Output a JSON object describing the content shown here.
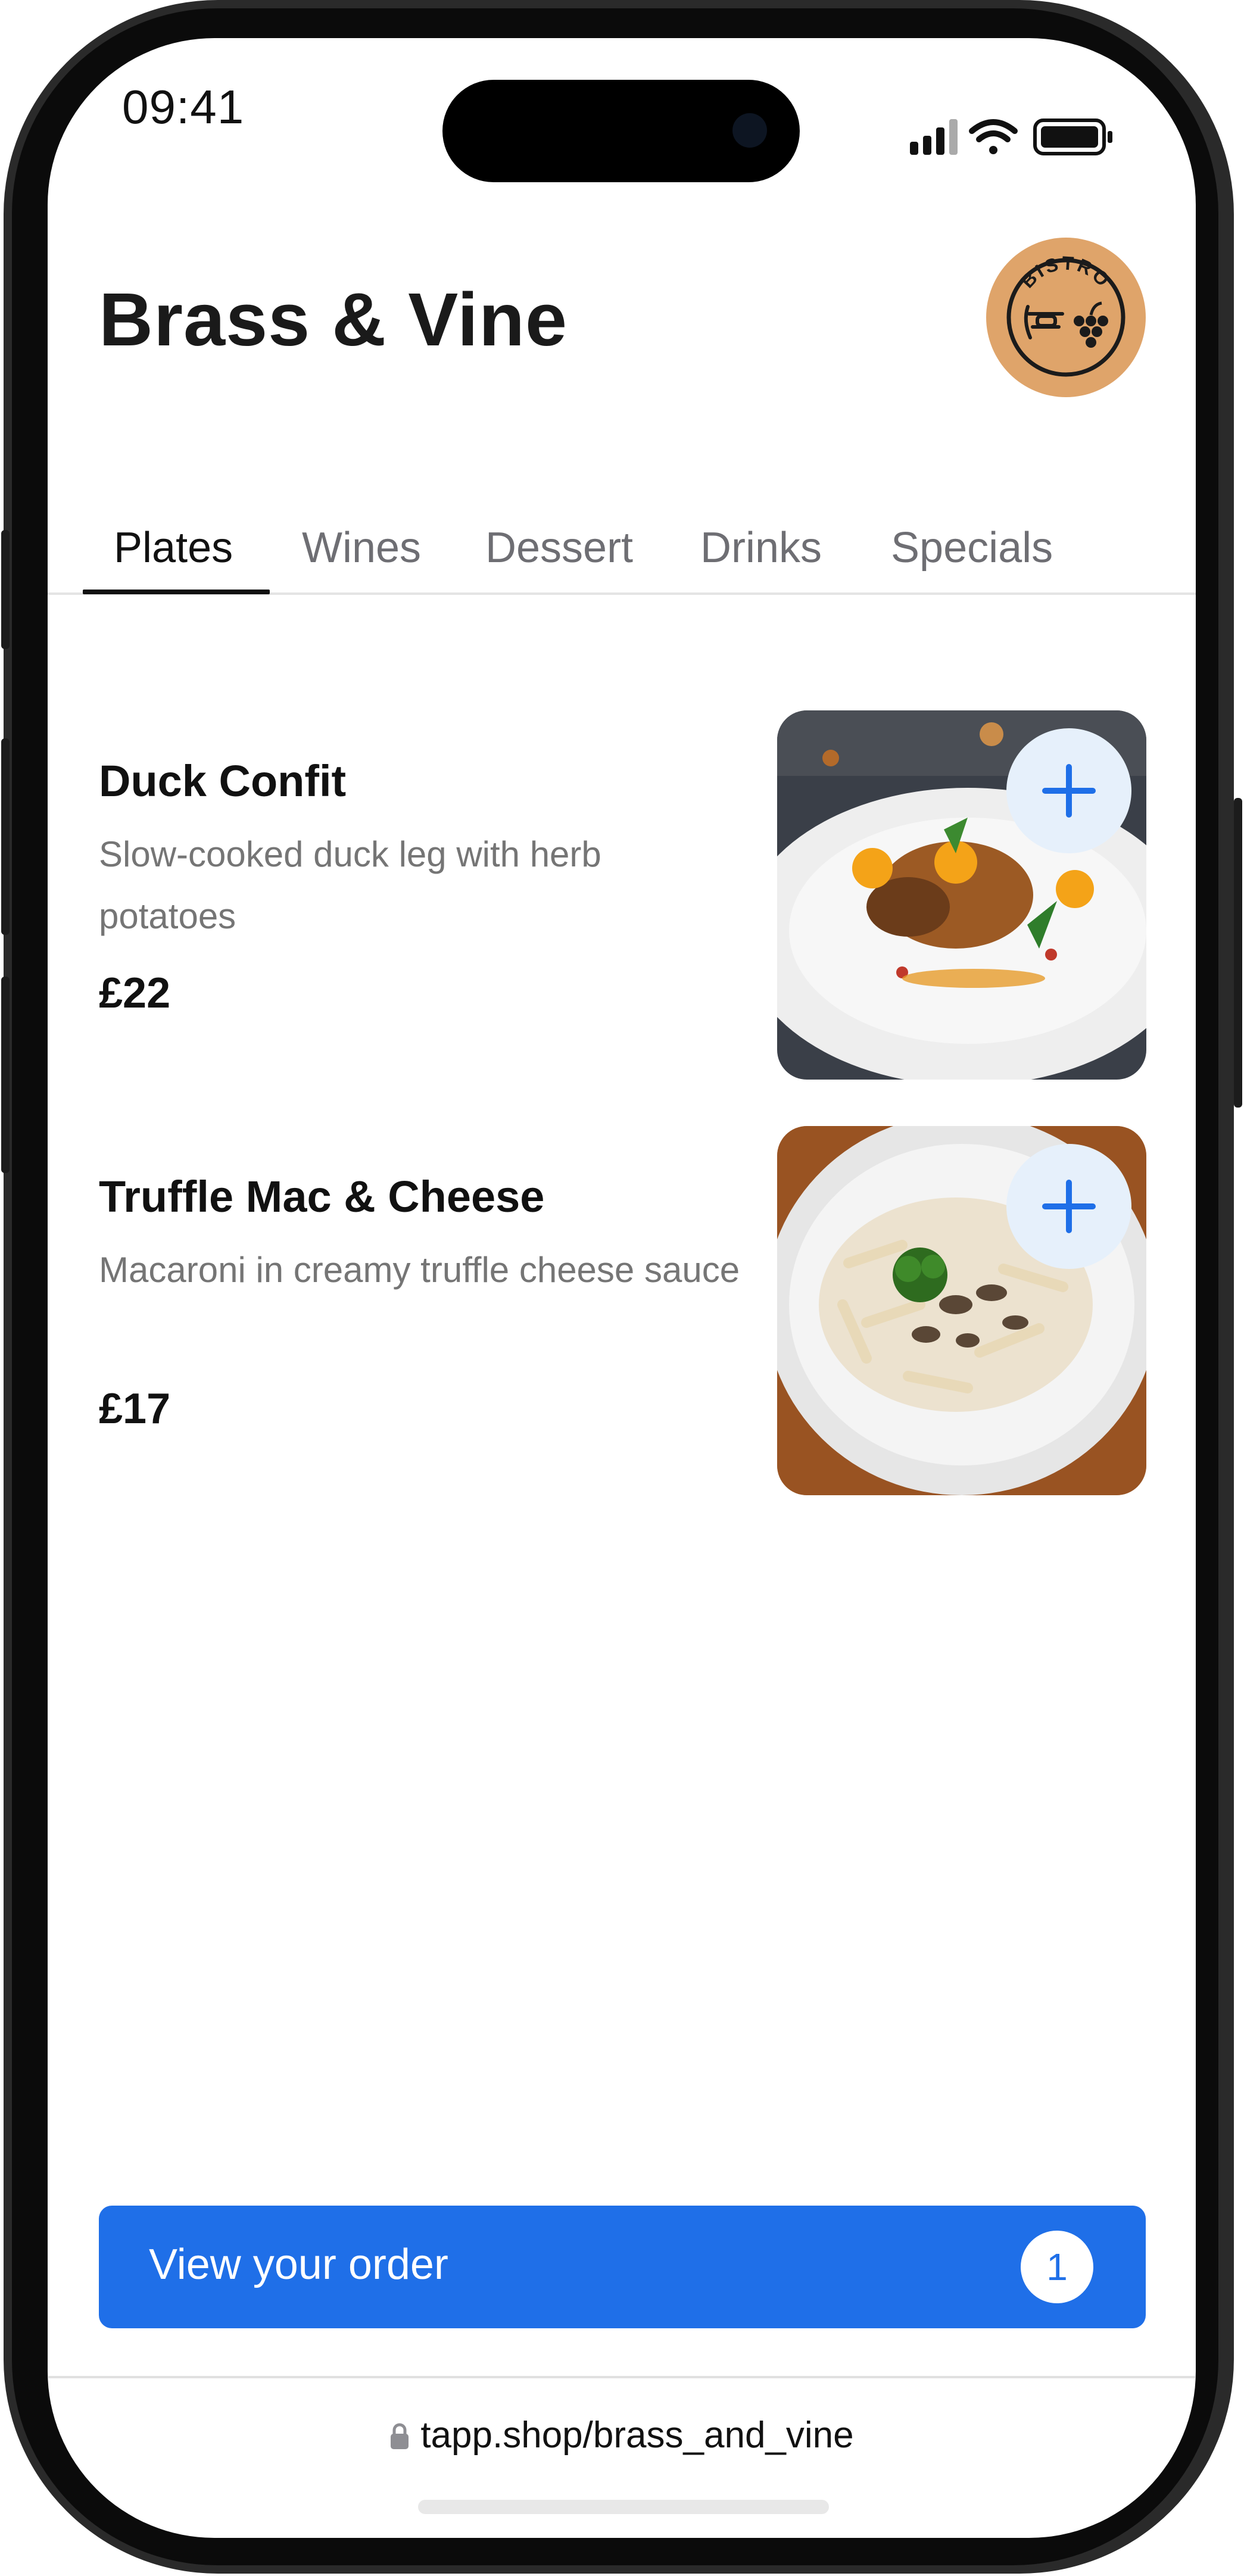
{
  "status_bar": {
    "time": "09:41"
  },
  "header": {
    "title": "Brass & Vine",
    "logo_text": "BISTRO"
  },
  "tabs": [
    {
      "label": "Plates",
      "active": true
    },
    {
      "label": "Wines",
      "active": false
    },
    {
      "label": "Dessert",
      "active": false
    },
    {
      "label": "Drinks",
      "active": false
    },
    {
      "label": "Specials",
      "active": false
    }
  ],
  "items": [
    {
      "name": "Duck Confit",
      "description": "Slow-cooked duck leg with herb potatoes",
      "price": "£22",
      "image": "roast-duck-plate"
    },
    {
      "name": "Truffle Mac & Cheese",
      "description": "Macaroni in creamy truffle cheese sauce",
      "price": "£17",
      "image": "creamy-pasta-plate"
    }
  ],
  "order": {
    "label": "View your order",
    "count": "1"
  },
  "browser": {
    "url": "tapp.shop/brass_and_vine"
  },
  "colors": {
    "accent": "#1f6fe8",
    "logo_bg": "#dfa46a",
    "add_bg": "#e6f0fb"
  },
  "icons": [
    "signal-icon",
    "wifi-icon",
    "battery-icon",
    "plus-icon",
    "lock-icon",
    "logo-badge"
  ]
}
